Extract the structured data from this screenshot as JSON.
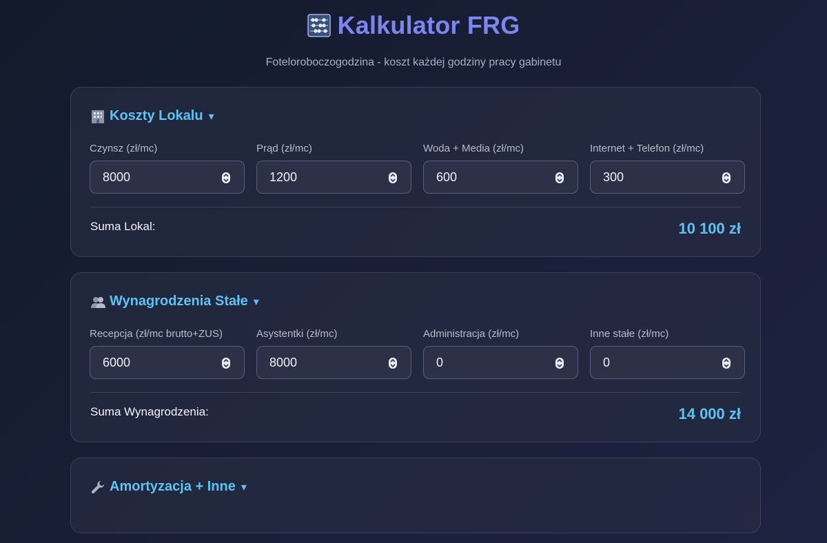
{
  "header": {
    "title": "Kalkulator FRG",
    "subtitle": "Fotelorobоczogodzina - koszt każdej godziny pracy gabinetu"
  },
  "sections": [
    {
      "title": "Koszty Lokalu",
      "icon": "building-icon",
      "caret": "▾",
      "fields": [
        {
          "label": "Czynsz (zł/mc)",
          "value": "8000"
        },
        {
          "label": "Prąd (zł/mc)",
          "value": "1200"
        },
        {
          "label": "Woda + Media (zł/mc)",
          "value": "600"
        },
        {
          "label": "Internet + Telefon (zł/mc)",
          "value": "300"
        }
      ],
      "sum_label": "Suma Lokal:",
      "sum_value": "10 100 zł"
    },
    {
      "title": "Wynagrodzenia Stałe",
      "icon": "people-icon",
      "caret": "▾",
      "fields": [
        {
          "label": "Recepcja (zł/mc brutto+ZUS)",
          "value": "6000"
        },
        {
          "label": "Asystentki (zł/mc)",
          "value": "8000"
        },
        {
          "label": "Administracja (zł/mc)",
          "value": "0"
        },
        {
          "label": "Inne stałe (zł/mc)",
          "value": "0"
        }
      ],
      "sum_label": "Suma Wynagrodzenia:",
      "sum_value": "14 000 zł"
    },
    {
      "title": "Amortyzacja + Inne",
      "icon": "wrench-icon",
      "caret": "▾"
    }
  ],
  "colors": {
    "title": "#7d86f0",
    "accent": "#5ec3f3",
    "background": "#171c30",
    "card": "#262b42"
  }
}
